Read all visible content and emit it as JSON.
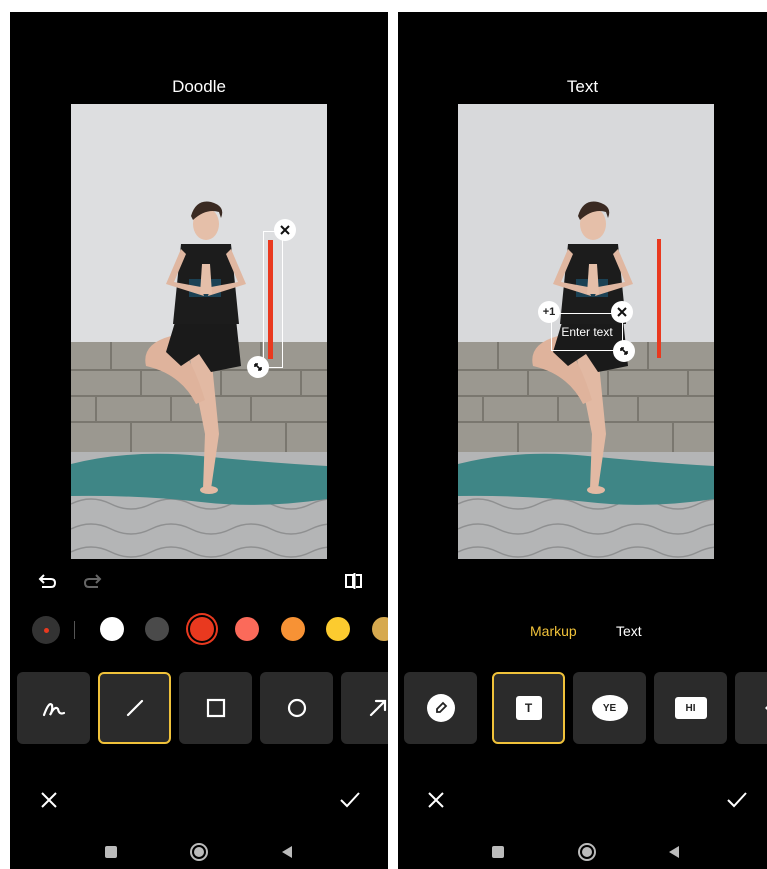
{
  "left": {
    "title": "Doodle",
    "colors": [
      "#ffffff",
      "#4a4a4a",
      "#e9391f",
      "#fb6a5a",
      "#f79235",
      "#fccb2f",
      "#d6a94e"
    ],
    "selected_color": "#e9391f",
    "tools": [
      "freehand",
      "line",
      "rectangle",
      "circle",
      "arrow"
    ],
    "selected_tool": "line"
  },
  "right": {
    "title": "Text",
    "text_box": {
      "placeholder": "Enter text",
      "badge": "+1"
    },
    "tabs": {
      "markup": "Markup",
      "text": "Text"
    },
    "active_tab": "Markup",
    "tools": [
      "pen",
      "text",
      "speech-bubble-ye",
      "speech-bubble-hi",
      "sign"
    ],
    "selected_tool": "text",
    "bubble_ye": "YE",
    "bubble_hi": "HI",
    "tool_text_glyph": "T"
  },
  "accent": "#f0c23a",
  "stroke_color": "#e9391f"
}
